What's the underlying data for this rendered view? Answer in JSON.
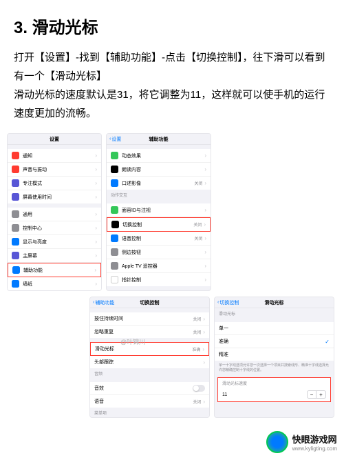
{
  "title": "3. 滑动光标",
  "body": "打开【设置】-找到【辅助功能】-点击【切换控制】，往下滑可以看到有一个【滑动光标】\n滑动光标的速度默认是31，将它调整为11，这样就可以使手机的运行速度更加的流畅。",
  "s1": {
    "title": "设置",
    "r": [
      "通知",
      "声音与振动",
      "专注模式",
      "屏幕使用时间",
      "通用",
      "控制中心",
      "显示与亮度",
      "主屏幕",
      "辅助功能",
      "墙纸"
    ]
  },
  "s2": {
    "back": "设置",
    "title": "辅助功能",
    "r": [
      "动态效果",
      "朗读内容",
      "口述影像"
    ],
    "val_off": "关闭",
    "g2": "动作交互",
    "r2": [
      "面容ID与注视",
      "切换控制",
      "语音控制",
      "侧边按钮",
      "Apple TV 遥控器",
      "指针控制"
    ],
    "v2": [
      "",
      "关闭",
      "关闭",
      "",
      "",
      ""
    ]
  },
  "s3": {
    "back": "辅助功能",
    "title": "切换控制",
    "r": [
      "按住持续时间",
      "忽略重复"
    ],
    "v": [
      "关闭",
      "关闭"
    ],
    "g2": "",
    "r2": [
      "滑动光标",
      "头部跟踪"
    ],
    "v2": [
      "准确",
      ""
    ],
    "g3": "音频",
    "r3": [
      "音效",
      "语音"
    ],
    "v3": [
      "",
      "关闭"
    ],
    "g4": "菜单项"
  },
  "s4": {
    "back": "切换控制",
    "title": "滑动光标",
    "g1": "滑动光标",
    "r1": [
      "单一",
      "准确",
      "精准"
    ],
    "sel": 1,
    "foot1": "单一十字线选项允许您一次选择一个项目并搜索线形、精准十字线选择允许您精确控制十字线的位置。",
    "g2": "滑动光标速度",
    "speed": "11"
  },
  "watermark": "@叶锦川",
  "logo": {
    "name": "快眼游戏网",
    "url": "www.kyligting.com"
  }
}
